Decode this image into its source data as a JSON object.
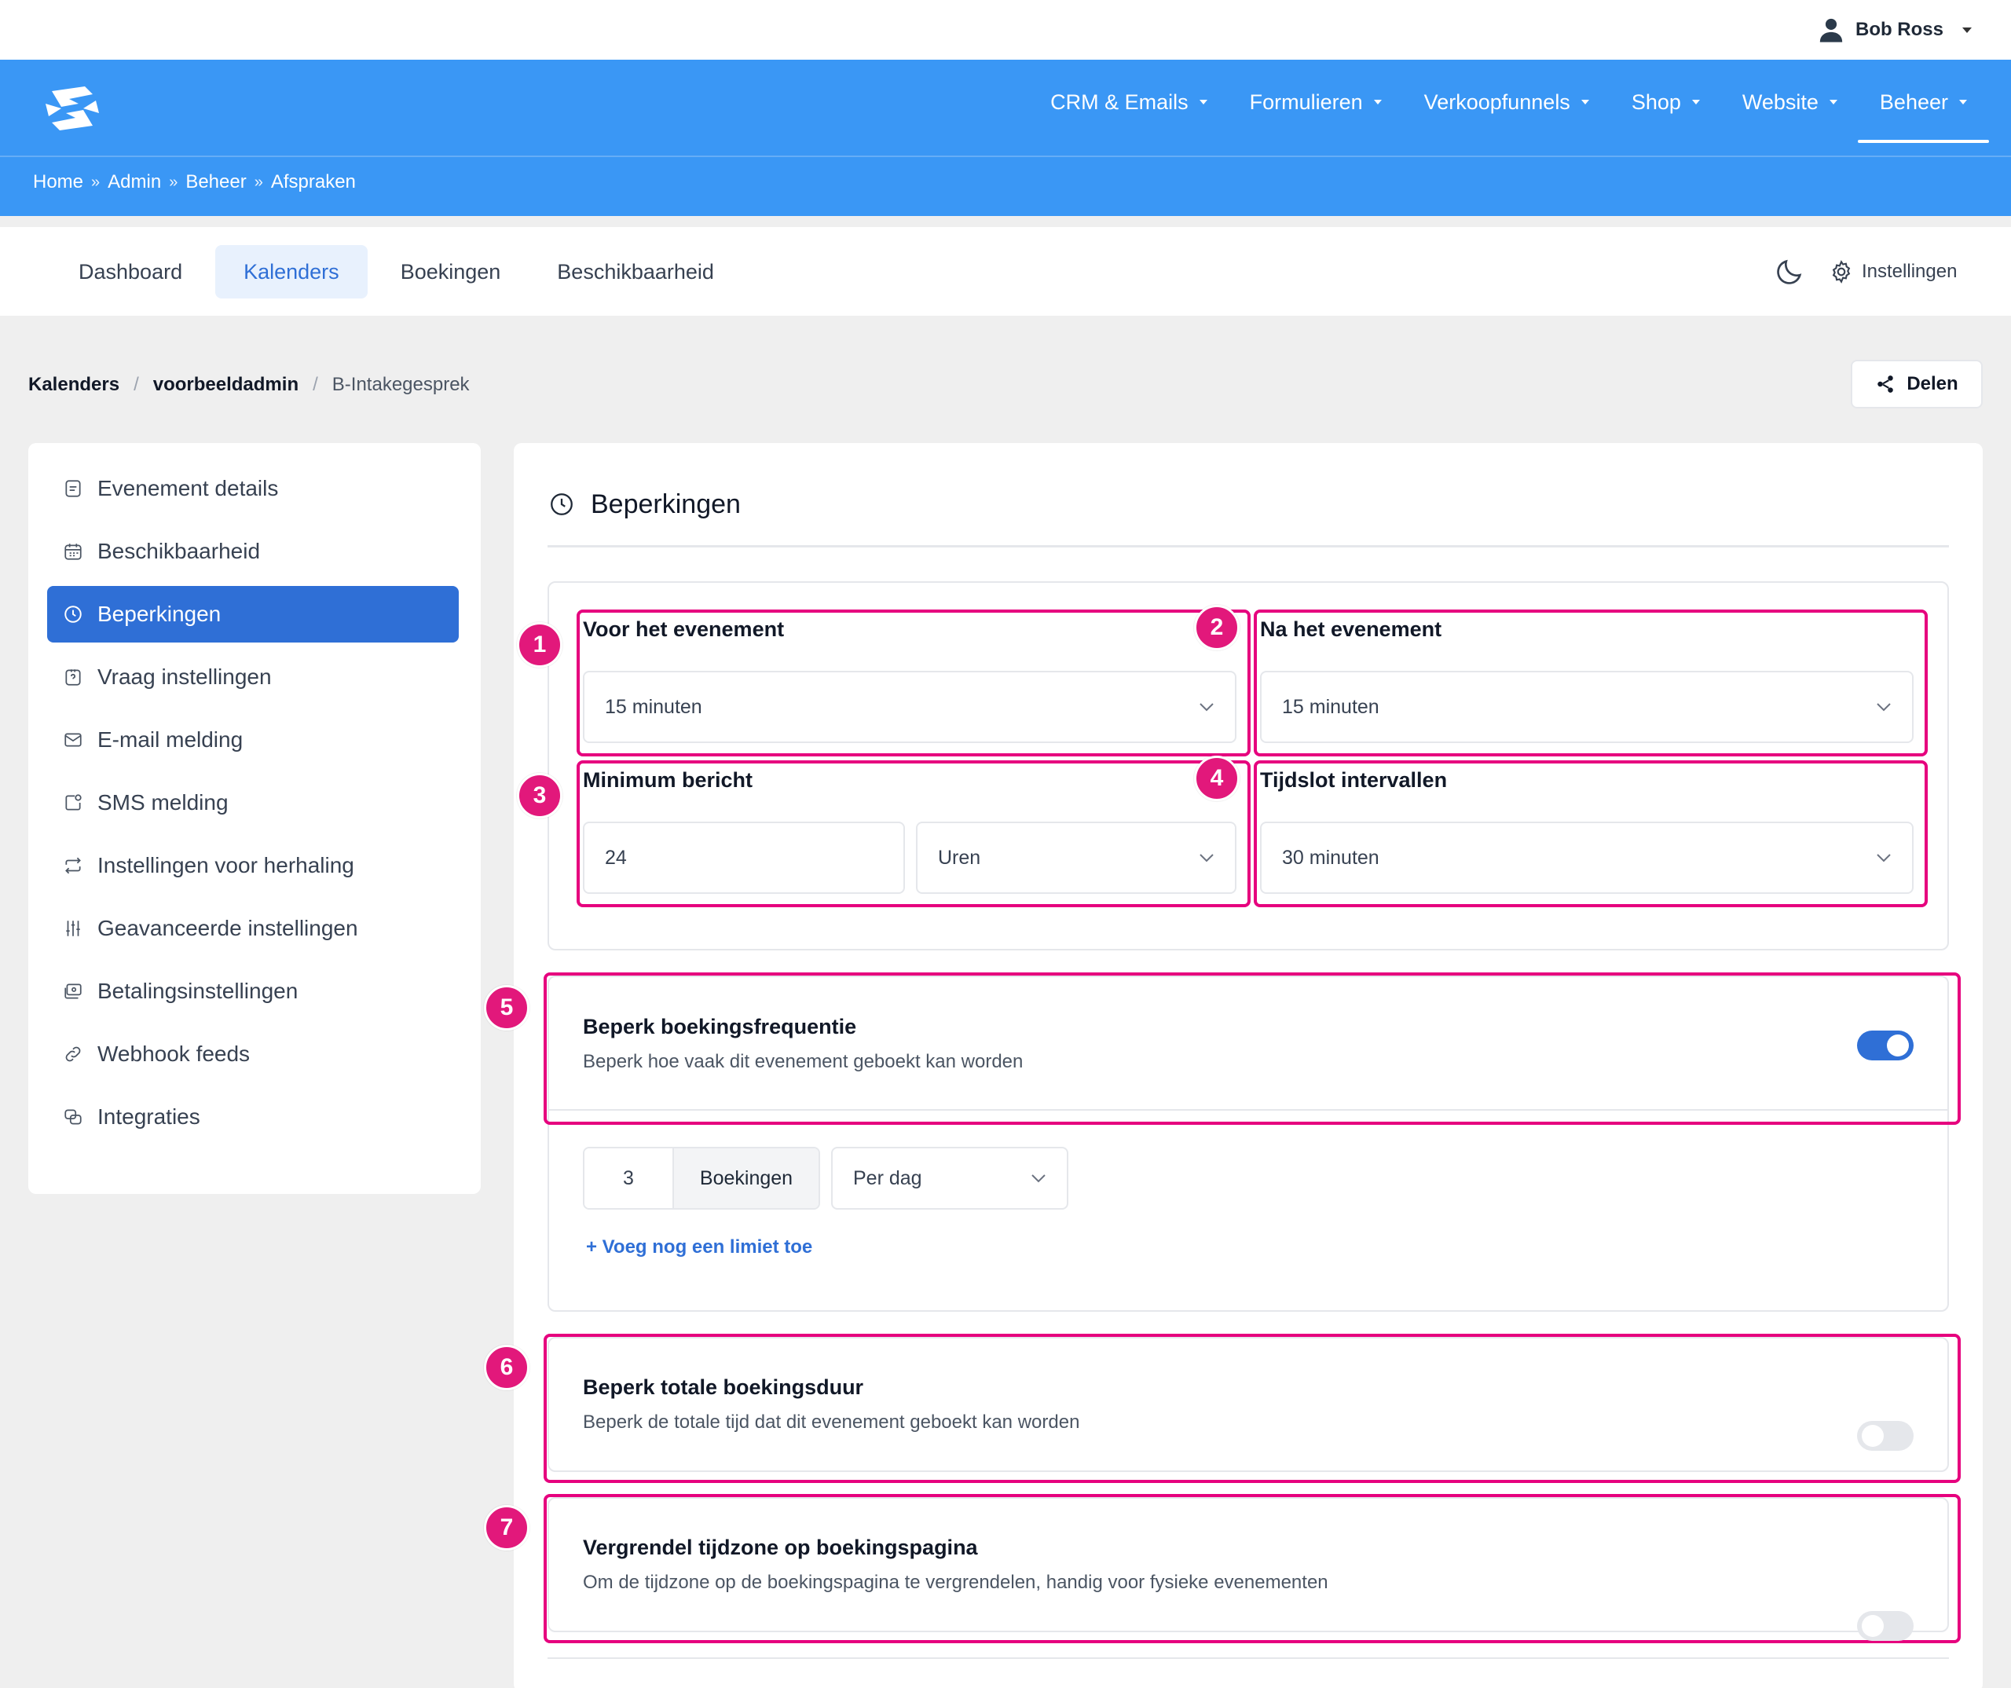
{
  "user": {
    "name": "Bob Ross"
  },
  "topnav": [
    {
      "label": "CRM & Emails"
    },
    {
      "label": "Formulieren"
    },
    {
      "label": "Verkoopfunnels"
    },
    {
      "label": "Shop"
    },
    {
      "label": "Website"
    },
    {
      "label": "Beheer",
      "active": true
    }
  ],
  "breadcrumb": [
    "Home",
    "Admin",
    "Beheer",
    "Afspraken"
  ],
  "breadcrumb_sep": "»",
  "tabs": [
    {
      "label": "Dashboard"
    },
    {
      "label": "Kalenders",
      "active": true
    },
    {
      "label": "Boekingen"
    },
    {
      "label": "Beschikbaarheid"
    }
  ],
  "settings_label": "Instellingen",
  "crumb2": {
    "root": "Kalenders",
    "owner": "voorbeeldadmin",
    "current": "B-Intakegesprek",
    "sep": "/"
  },
  "share_label": "Delen",
  "sidebar": [
    {
      "label": "Evenement details",
      "icon": "document-icon"
    },
    {
      "label": "Beschikbaarheid",
      "icon": "calendar-icon"
    },
    {
      "label": "Beperkingen",
      "icon": "clock-icon",
      "active": true
    },
    {
      "label": "Vraag instellingen",
      "icon": "question-icon"
    },
    {
      "label": "E-mail melding",
      "icon": "mail-icon"
    },
    {
      "label": "SMS melding",
      "icon": "sms-icon"
    },
    {
      "label": "Instellingen voor herhaling",
      "icon": "repeat-icon"
    },
    {
      "label": "Geavanceerde instellingen",
      "icon": "sliders-icon"
    },
    {
      "label": "Betalingsinstellingen",
      "icon": "payment-icon"
    },
    {
      "label": "Webhook feeds",
      "icon": "link-icon"
    },
    {
      "label": "Integraties",
      "icon": "integration-icon"
    }
  ],
  "main": {
    "title": "Beperkingen",
    "before": {
      "badge": "1",
      "label": "Voor het evenement",
      "value": "15 minuten"
    },
    "after": {
      "badge": "2",
      "label": "Na het evenement",
      "value": "15 minuten"
    },
    "minimum": {
      "badge": "3",
      "label": "Minimum bericht",
      "number": "24",
      "unit": "Uren"
    },
    "interval": {
      "badge": "4",
      "label": "Tijdslot intervallen",
      "value": "30 minuten"
    },
    "frequency": {
      "badge": "5",
      "title": "Beperk boekingsfrequentie",
      "subtitle": "Beperk hoe vaak dit evenement geboekt kan worden",
      "enabled": true,
      "count": "3",
      "count_unit": "Boekingen",
      "period": "Per dag",
      "add_limit": "+ Voeg nog een limiet toe"
    },
    "duration": {
      "badge": "6",
      "title": "Beperk totale boekingsduur",
      "subtitle": "Beperk de totale tijd dat dit evenement geboekt kan worden",
      "enabled": false
    },
    "timezone": {
      "badge": "7",
      "title": "Vergrendel tijdzone op boekingspagina",
      "subtitle": "Om de tijdzone op de boekingspagina te vergrendelen, handig voor fysieke evenementen",
      "enabled": false
    }
  },
  "colors": {
    "brand_blue": "#3a97f5",
    "active_blue": "#2f6fd6",
    "annotation_pink": "#e6007e"
  }
}
